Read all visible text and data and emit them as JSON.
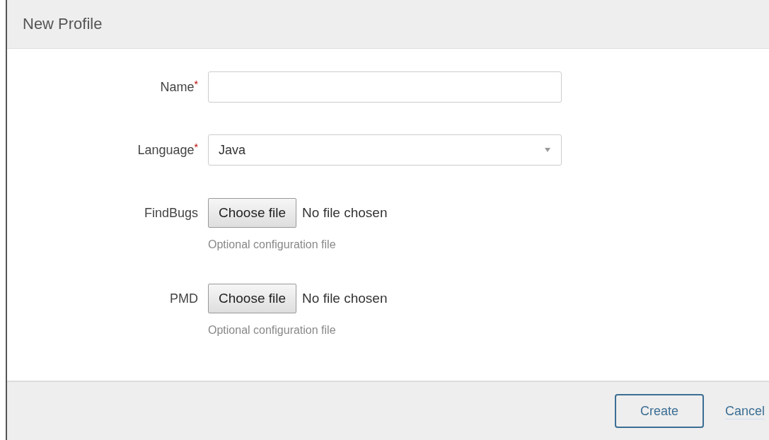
{
  "dialog": {
    "title": "New Profile"
  },
  "fields": [
    {
      "kind": "text",
      "label": "Name",
      "required_mark": "*"
    },
    {
      "kind": "select",
      "label": "Language",
      "required_mark": "*",
      "value": "Java"
    },
    {
      "kind": "file",
      "label": "FindBugs",
      "button": "Choose file",
      "status": "No file chosen",
      "help": "Optional configuration file"
    },
    {
      "kind": "file",
      "label": "PMD",
      "button": "Choose file",
      "status": "No file chosen",
      "help": "Optional configuration file"
    }
  ],
  "footer": {
    "primary": "Create",
    "link": "Cancel"
  }
}
